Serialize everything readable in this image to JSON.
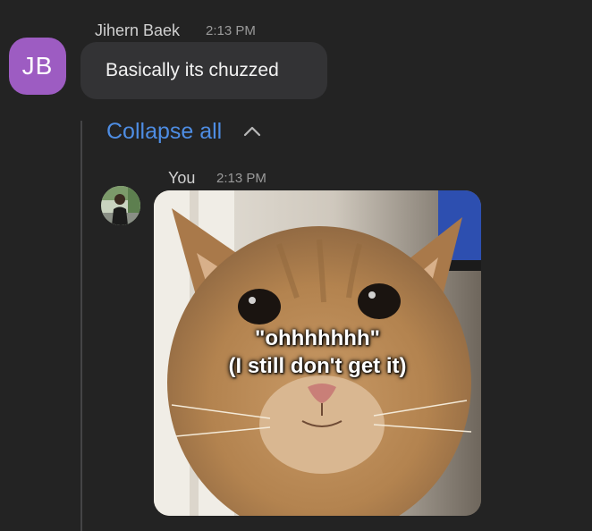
{
  "message_1": {
    "avatar_initials": "JB",
    "avatar_color": "#9d5cc2",
    "sender": "Jihern Baek",
    "time": "2:13 PM",
    "text": "Basically its chuzzed"
  },
  "thread": {
    "collapse_label": "Collapse all",
    "collapse_icon": "chevron-up-icon",
    "link_color": "#4e8de3"
  },
  "message_2": {
    "sender": "You",
    "time": "2:13 PM",
    "image": {
      "subject": "orange tabby cat meme",
      "caption_line_1": "\"ohhhhhhh\"",
      "caption_line_2": "(I still don't get it)"
    }
  }
}
